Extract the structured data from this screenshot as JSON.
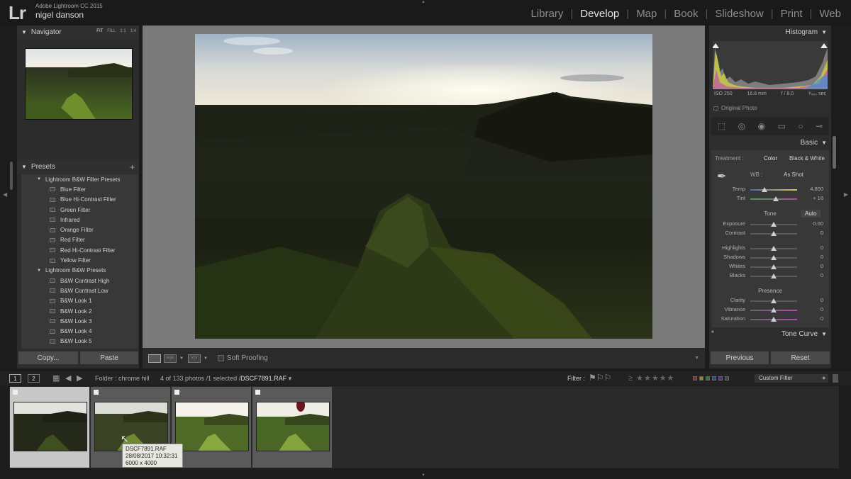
{
  "app": {
    "logo": "Lr",
    "name": "Adobe Lightroom CC 2015",
    "user": "nigel danson"
  },
  "modules": [
    {
      "label": "Library",
      "active": false
    },
    {
      "label": "Develop",
      "active": true
    },
    {
      "label": "Map",
      "active": false
    },
    {
      "label": "Book",
      "active": false
    },
    {
      "label": "Slideshow",
      "active": false
    },
    {
      "label": "Print",
      "active": false
    },
    {
      "label": "Web",
      "active": false
    }
  ],
  "navigator": {
    "title": "Navigator",
    "options": [
      "FIT",
      "FILL",
      "1:1",
      "1:4"
    ]
  },
  "presets": {
    "title": "Presets",
    "add_label": "+",
    "folders": [
      {
        "name": "Lightroom B&W Filter Presets",
        "items": [
          "Blue Filter",
          "Blue Hi-Contrast Filter",
          "Green Filter",
          "Infrared",
          "Orange Filter",
          "Red Filter",
          "Red Hi-Contrast Filter",
          "Yellow Filter"
        ]
      },
      {
        "name": "Lightroom B&W Presets",
        "items": [
          "B&W Contrast High",
          "B&W Contrast Low",
          "B&W Look 1",
          "B&W Look 2",
          "B&W Look 3",
          "B&W Look 4",
          "B&W Look 5"
        ]
      }
    ]
  },
  "left_buttons": {
    "copy": "Copy...",
    "paste": "Paste"
  },
  "toolbar": {
    "soft_proofing": "Soft Proofing"
  },
  "histogram": {
    "title": "Histogram",
    "iso": "ISO 250",
    "focal": "16.6 mm",
    "aperture": "f / 8.0",
    "shutter": "¹⁄₄₅₀ sec",
    "original_photo": "Original Photo"
  },
  "basic": {
    "title": "Basic",
    "treatment_label": "Treatment :",
    "treatment_color": "Color",
    "treatment_bw": "Black & White",
    "wb_label": "WB :",
    "wb_value": "As Shot",
    "wb_sliders": [
      {
        "label": "Temp",
        "value": "4,800",
        "pos": 0.3
      },
      {
        "label": "Tint",
        "value": "+ 16",
        "pos": 0.55
      }
    ],
    "tone_label": "Tone",
    "auto_label": "Auto",
    "tone_sliders": [
      {
        "label": "Exposure",
        "value": "0.00",
        "pos": 0.5
      },
      {
        "label": "Contrast",
        "value": "0",
        "pos": 0.5
      }
    ],
    "tone2_sliders": [
      {
        "label": "Highlights",
        "value": "0",
        "pos": 0.5
      },
      {
        "label": "Shadows",
        "value": "0",
        "pos": 0.5
      },
      {
        "label": "Whites",
        "value": "0",
        "pos": 0.5
      },
      {
        "label": "Blacks",
        "value": "0",
        "pos": 0.5
      }
    ],
    "presence_label": "Presence",
    "presence_sliders": [
      {
        "label": "Clarity",
        "value": "0",
        "pos": 0.5
      },
      {
        "label": "Vibrance",
        "value": "0",
        "pos": 0.5
      },
      {
        "label": "Saturation",
        "value": "0",
        "pos": 0.5
      }
    ]
  },
  "tone_curve": {
    "title": "Tone Curve"
  },
  "right_buttons": {
    "previous": "Previous",
    "reset": "Reset"
  },
  "filmstrip_bar": {
    "view1": "1",
    "view2": "2",
    "folder": "Folder : chrome hill",
    "count": "4 of 133 photos /1 selected /",
    "file": "DSCF7891.RAF",
    "filter_label": "Filter :",
    "stars_prefix": "≥",
    "stars": "★★★★★",
    "custom_filter": "Custom Filter"
  },
  "tooltip": {
    "file": "DSCF7891.RAF",
    "date": "28/08/2017 10:32:31",
    "dims": "6000 x 4000"
  },
  "colors": {
    "panel": "#2d2d2d",
    "canvas": "#7a7a7a",
    "accent_text": "#e6e6e6"
  }
}
